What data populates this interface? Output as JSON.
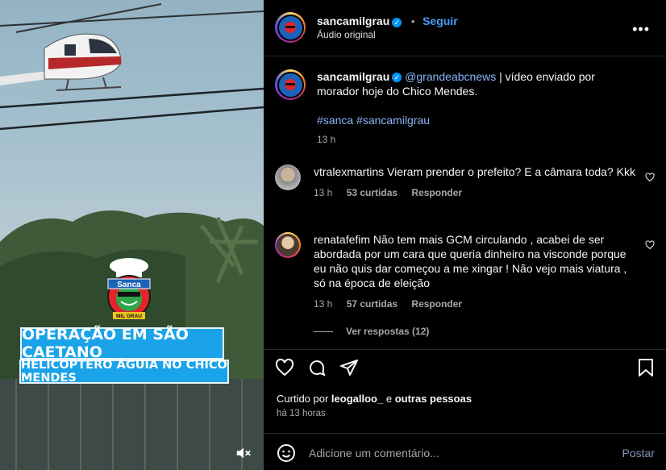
{
  "post": {
    "username": "sancamilgrau",
    "follow_label": "Seguir",
    "audio": "Áudio original",
    "caption_mention": "@grandeabcnews",
    "caption_text": " | vídeo enviado por morador hoje do Chico Mendes.",
    "hashtags": "#sanca #sancamilgrau",
    "caption_time": "13 h"
  },
  "video": {
    "logo_text": "Sanca",
    "logo_sub": "MIL GRAU",
    "overlay_line1": "OPERAÇÃO EM SÃO CAETANO",
    "overlay_line2": "HELICÓPTERO ÁGUIA NO CHICO MENDES"
  },
  "comments": [
    {
      "username": "vtralexmartins",
      "text": " Vieram prender o prefeito? E a câmara toda? Kkk",
      "time": "13 h",
      "likes": "53 curtidas",
      "reply": "Responder"
    },
    {
      "username": "renatafefim",
      "text": " Não tem mais GCM circulando , acabei de ser abordada por um cara que queria dinheiro na visconde porque eu não quis dar começou a me xingar ! Não vejo mais viatura , só na época de eleição",
      "time": "13 h",
      "likes": "57 curtidas",
      "reply": "Responder",
      "view_replies": "Ver respostas (12)"
    }
  ],
  "likes_line": {
    "prefix": "Curtido por ",
    "user": "leogalloo_",
    "middle": " e ",
    "others": "outras pessoas"
  },
  "post_time": "há 13 horas",
  "add_comment": {
    "placeholder": "Adicione um comentário...",
    "post_label": "Postar"
  },
  "colors": {
    "accent": "#0095f6",
    "overlay": "#1aa3e8"
  }
}
